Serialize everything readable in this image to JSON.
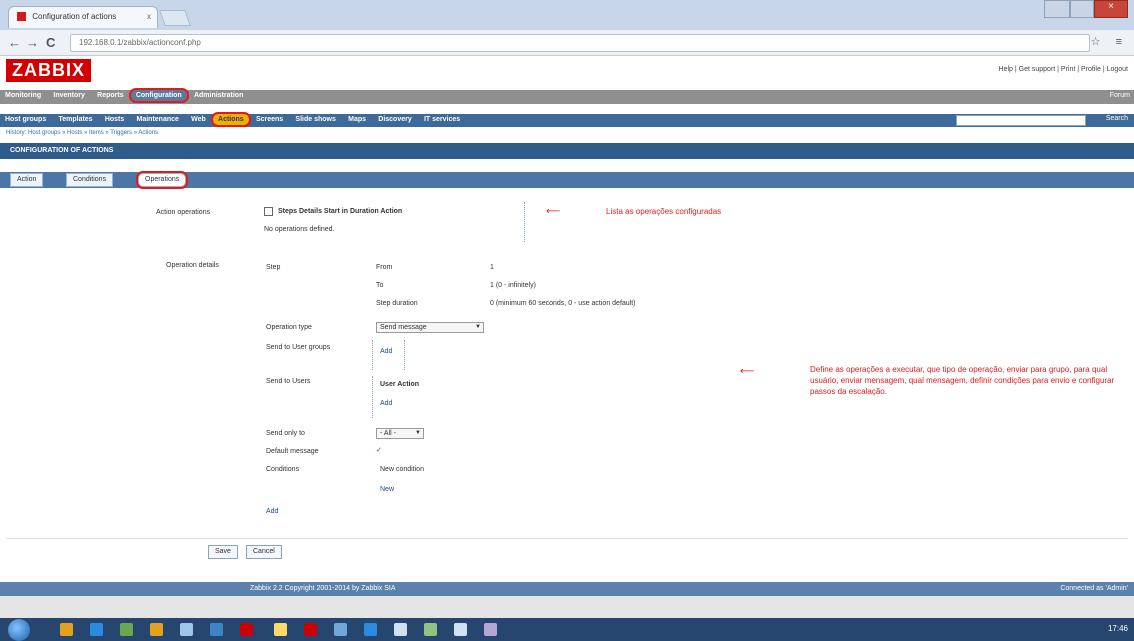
{
  "browser": {
    "tab_title": "Configuration of actions",
    "tab_close": "x",
    "url": "192.168.0.1/zabbix/actionconf.php",
    "nav_back": "←",
    "nav_forward": "→",
    "nav_reload": "C",
    "toolbar_icons": "☆ ≡"
  },
  "zabbix": {
    "logo": "ZABBIX",
    "top_links": "Help | Get support | Print | Profile | Logout",
    "main_menu": [
      "Monitoring",
      "Inventory",
      "Reports",
      "Configuration",
      "Administration"
    ],
    "main_menu_selected": 3,
    "main_menu_right": "Forum",
    "sub_menu": [
      "Host groups",
      "Templates",
      "Hosts",
      "Maintenance",
      "Web",
      "Actions",
      "Screens",
      "Slide shows",
      "Maps",
      "Discovery",
      "IT services"
    ],
    "sub_menu_selected": 5,
    "search_button": "Search",
    "history": "History: Host groups » Hosts » Items » Triggers » Actions",
    "page_title": "CONFIGURATION OF ACTIONS",
    "tabs": [
      "Action",
      "Conditions",
      "Operations"
    ],
    "tabs_selected": 2
  },
  "form": {
    "default_operations_label": "Action operations",
    "operation_columns": "Steps   Details   Start in   Duration   Action",
    "no_operations": "No operations defined.",
    "annotation_top": "Lista as operações configuradas",
    "operation_details_label": "Operation details",
    "step_label": "Step",
    "from_label": "From",
    "from_value": "1",
    "to_label": "To",
    "to_value": "1   (0 - infinitely)",
    "step_duration_label": "Step duration",
    "step_duration_value": "0   (minimum 60 seconds, 0 - use action default)",
    "operation_type_label": "Operation type",
    "operation_type_value": "Send message",
    "send_user_groups_label": "Send to User groups",
    "send_users_label": "Send to Users",
    "add_label": "Add",
    "users_header": "User   Action",
    "send_only_to_label": "Send only to",
    "send_only_to_value": "- All -",
    "default_message_label": "Default message",
    "default_message_value": "✓",
    "conditions_label": "Conditions",
    "new_condition": "New condition",
    "new_link": "New",
    "add_operation_link": "Add",
    "annotation_right": "Define as operações a executar, que tipo de operação, enviar para grupo, para qual usuário, enviar mensagem, qual mensagem, definir condições para envio e configurar passos da escalação."
  },
  "buttons": {
    "save": "Save",
    "cancel": "Cancel"
  },
  "footer": {
    "copyright": "Zabbix 2.2 Copyright 2001-2014 by Zabbix SIA",
    "connected": "Connected as 'Admin'"
  },
  "taskbar": {
    "clock": "17:46"
  }
}
